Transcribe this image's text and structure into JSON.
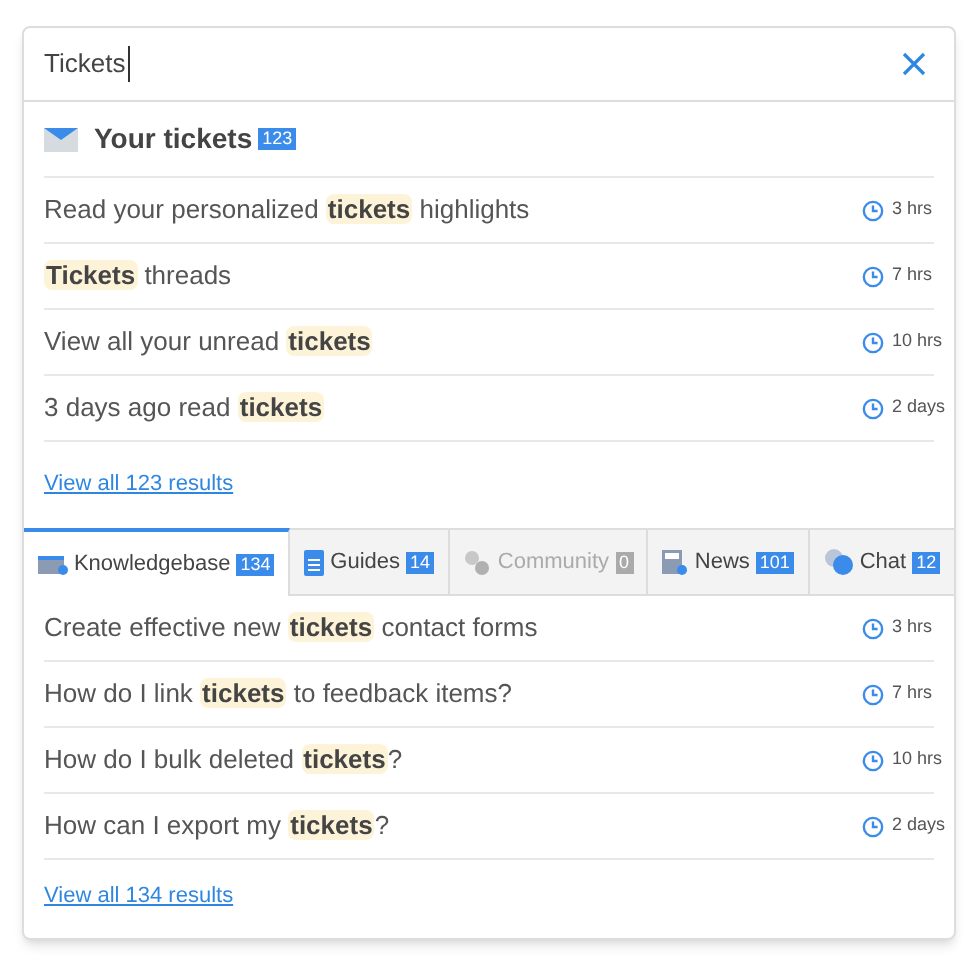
{
  "search": {
    "value": "Tickets"
  },
  "tickets": {
    "title": "Your tickets",
    "count": "123",
    "results": [
      {
        "parts": [
          {
            "text": "Read your personalized "
          },
          {
            "text": "tickets",
            "highlight": true
          },
          {
            "text": " highlights"
          }
        ],
        "time": "3 hrs"
      },
      {
        "parts": [
          {
            "text": "Tickets",
            "highlight": true
          },
          {
            "text": " threads"
          }
        ],
        "time": "7 hrs"
      },
      {
        "parts": [
          {
            "text": "View all your unread "
          },
          {
            "text": "tickets",
            "highlight": true
          }
        ],
        "time": "10 hrs"
      },
      {
        "parts": [
          {
            "text": "3 days ago read "
          },
          {
            "text": "tickets",
            "highlight": true
          }
        ],
        "time": "2 days"
      }
    ],
    "view_all": "View all 123 results"
  },
  "tabs": [
    {
      "kind": "knowledgebase",
      "label": "Knowledgebase",
      "count": "134",
      "selected": true,
      "disabled": false
    },
    {
      "kind": "guides",
      "label": "Guides",
      "count": "14",
      "selected": false,
      "disabled": false
    },
    {
      "kind": "community",
      "label": "Community",
      "count": "0",
      "selected": false,
      "disabled": true
    },
    {
      "kind": "news",
      "label": "News",
      "count": "101",
      "selected": false,
      "disabled": false
    },
    {
      "kind": "chat",
      "label": "Chat",
      "count": "12",
      "selected": false,
      "disabled": false
    }
  ],
  "articles": {
    "results": [
      {
        "parts": [
          {
            "text": "Create effective new "
          },
          {
            "text": "tickets",
            "highlight": true
          },
          {
            "text": " contact forms"
          }
        ],
        "time": "3 hrs"
      },
      {
        "parts": [
          {
            "text": "How do I link "
          },
          {
            "text": "tickets",
            "highlight": true
          },
          {
            "text": " to feedback items?"
          }
        ],
        "time": "7 hrs"
      },
      {
        "parts": [
          {
            "text": "How do I bulk deleted "
          },
          {
            "text": "tickets",
            "highlight": true
          },
          {
            "text": "?"
          }
        ],
        "time": "10 hrs"
      },
      {
        "parts": [
          {
            "text": "How can I export my "
          },
          {
            "text": "tickets",
            "highlight": true
          },
          {
            "text": "?"
          }
        ],
        "time": "2 days"
      }
    ],
    "view_all": "View all 134 results"
  }
}
